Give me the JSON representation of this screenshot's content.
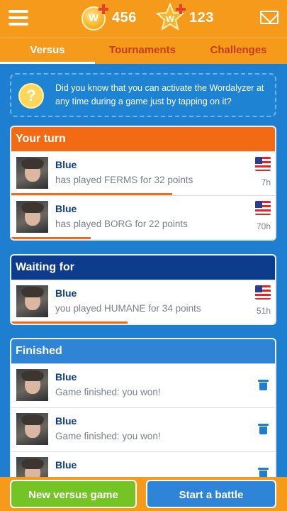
{
  "header": {
    "coins": "456",
    "stars": "123",
    "coin_letter": "W",
    "star_letter": "W"
  },
  "tabs": [
    {
      "label": "Versus",
      "active": true
    },
    {
      "label": "Tournaments",
      "active": false
    },
    {
      "label": "Challenges",
      "active": false
    }
  ],
  "tip": {
    "icon": "?",
    "text": "Did you know that you can activate the Wordalyzer at any time during a game just by tapping on it?"
  },
  "sections": {
    "your_turn": {
      "title": "Your turn",
      "rows": [
        {
          "name": "Blue",
          "detail": "has played FERMS for 32 points",
          "time": "7h",
          "progress": 0.61
        },
        {
          "name": "Blue",
          "detail": "has played BORG for 22 points",
          "time": "70h",
          "progress": 0.3
        }
      ]
    },
    "waiting_for": {
      "title": "Waiting for",
      "rows": [
        {
          "name": "Blue",
          "detail": "you played HUMANE for 34 points",
          "time": "51h",
          "progress": 0.44
        }
      ]
    },
    "finished": {
      "title": "Finished",
      "rows": [
        {
          "name": "Blue",
          "detail": "Game finished: you won!"
        },
        {
          "name": "Blue",
          "detail": "Game finished: you won!"
        },
        {
          "name": "Blue",
          "detail": ""
        }
      ]
    }
  },
  "footer": {
    "new_game_label": "New versus game",
    "battle_label": "Start a battle"
  },
  "colors": {
    "orange": "#f59a1b",
    "your_turn_header": "#f36a14",
    "waiting_header": "#0e3c8c",
    "finished_header": "#2f84d6",
    "background": "#1e7fd0",
    "green_button": "#73c424",
    "blue_button": "#2e84d6"
  },
  "icons": [
    "menu-icon",
    "coin-icon",
    "star-icon",
    "mail-icon",
    "bulb-icon",
    "flag-icon",
    "trash-icon"
  ]
}
